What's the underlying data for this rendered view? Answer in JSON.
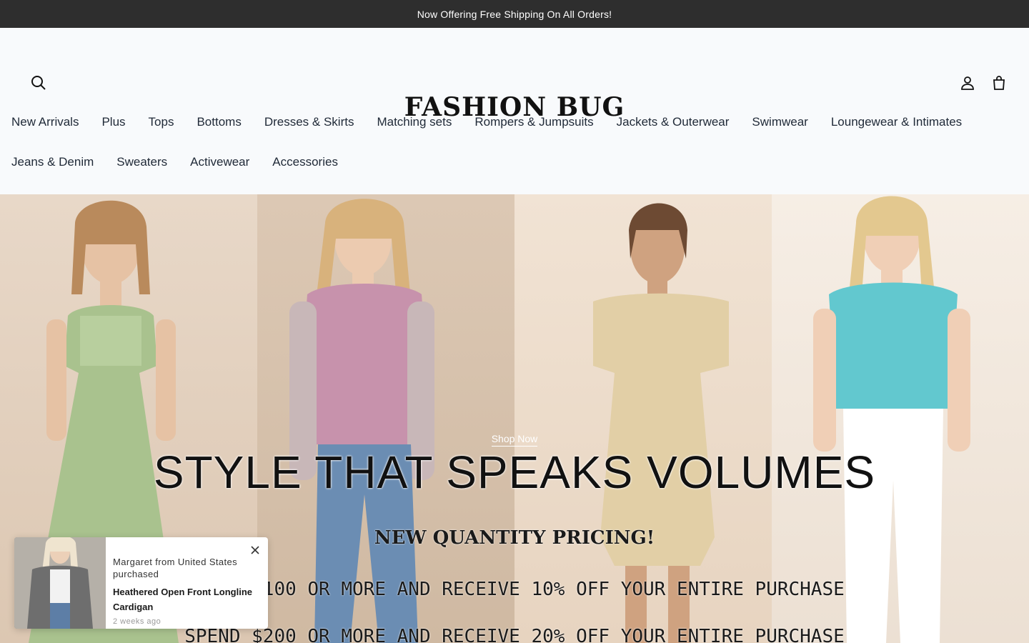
{
  "announcement": "Now Offering Free Shipping On All Orders!",
  "header": {
    "logo": "FASHION BUG",
    "icons": {
      "search": "search-icon",
      "account": "user-icon",
      "cart": "shopping-bag-icon"
    }
  },
  "nav": {
    "row1": [
      "New Arrivals",
      "Plus",
      "Tops",
      "Bottoms",
      "Dresses & Skirts",
      "Matching sets",
      "Rompers & Jumpsuits",
      "Jackets & Outerwear",
      "Swimwear",
      "Loungewear & Intimates"
    ],
    "row2": [
      "Jeans & Denim",
      "Sweaters",
      "Activewear",
      "Accessories"
    ]
  },
  "hero": {
    "cta": "Shop Now",
    "title": "STYLE THAT SPEAKS VOLUMES",
    "subtitle": "NEW QUANTITY PRICING!",
    "promo_line_1": "SPEND $100 OR MORE AND RECEIVE 10% OFF YOUR ENTIRE PURCHASE",
    "promo_line_2": "SPEND $200 OR MORE AND RECEIVE 20% OFF YOUR ENTIRE PURCHASE"
  },
  "toast": {
    "message": "Margaret from United States purchased",
    "product": "Heathered Open Front Longline Cardigan",
    "time": "2 weeks ago"
  },
  "colors": {
    "announcement_bg": "#2e2e2e",
    "page_bg": "#f8fafc",
    "text": "#1a1a1a"
  }
}
